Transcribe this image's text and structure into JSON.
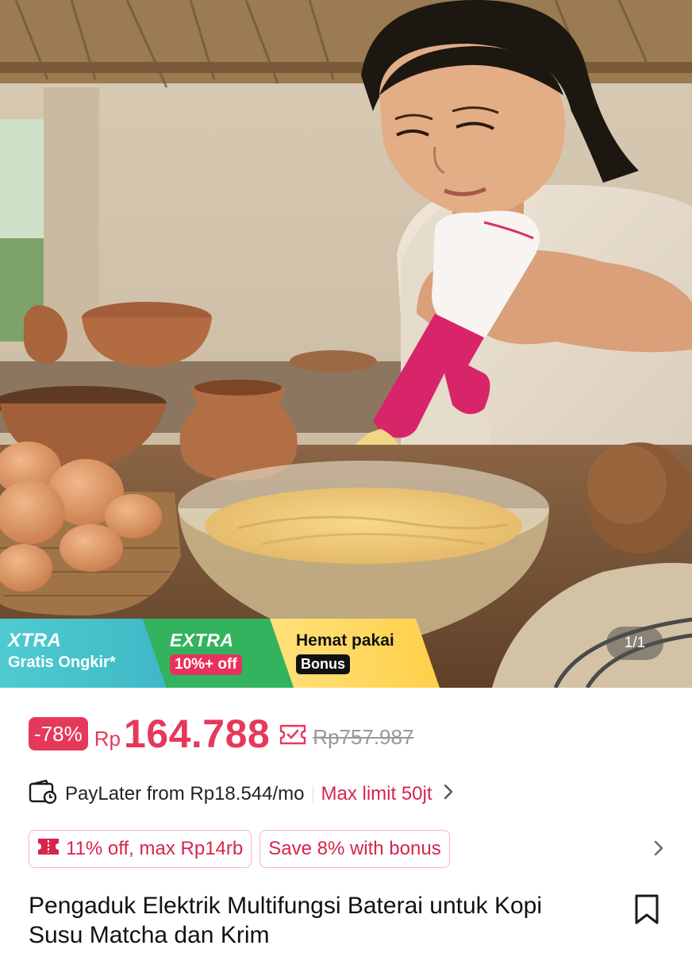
{
  "hero": {
    "promos": {
      "xtra": {
        "title": "XTRA",
        "subtitle": "Gratis Ongkir*"
      },
      "extra": {
        "title": "EXTRA",
        "badge": "10%+ off"
      },
      "hemat": {
        "title": "Hemat pakai",
        "badge": "Bonus"
      }
    },
    "counter": "1/1"
  },
  "price": {
    "discount": "-78%",
    "currency": "Rp",
    "current": "164.788",
    "original": "Rp757.987"
  },
  "paylater": {
    "text": "PayLater from Rp18.544/mo",
    "limit": "Max limit 50jt"
  },
  "coupons": [
    {
      "label": "11% off, max Rp14rb"
    },
    {
      "label": "Save 8% with bonus"
    }
  ],
  "product": {
    "title": "Pengaduk Elektrik Multifungsi Baterai untuk Kopi Susu Matcha dan Krim"
  },
  "colors": {
    "accent": "#e5395c",
    "xtra": "#4fcbd0",
    "extra": "#33b35e",
    "hemat": "#ffd559"
  }
}
